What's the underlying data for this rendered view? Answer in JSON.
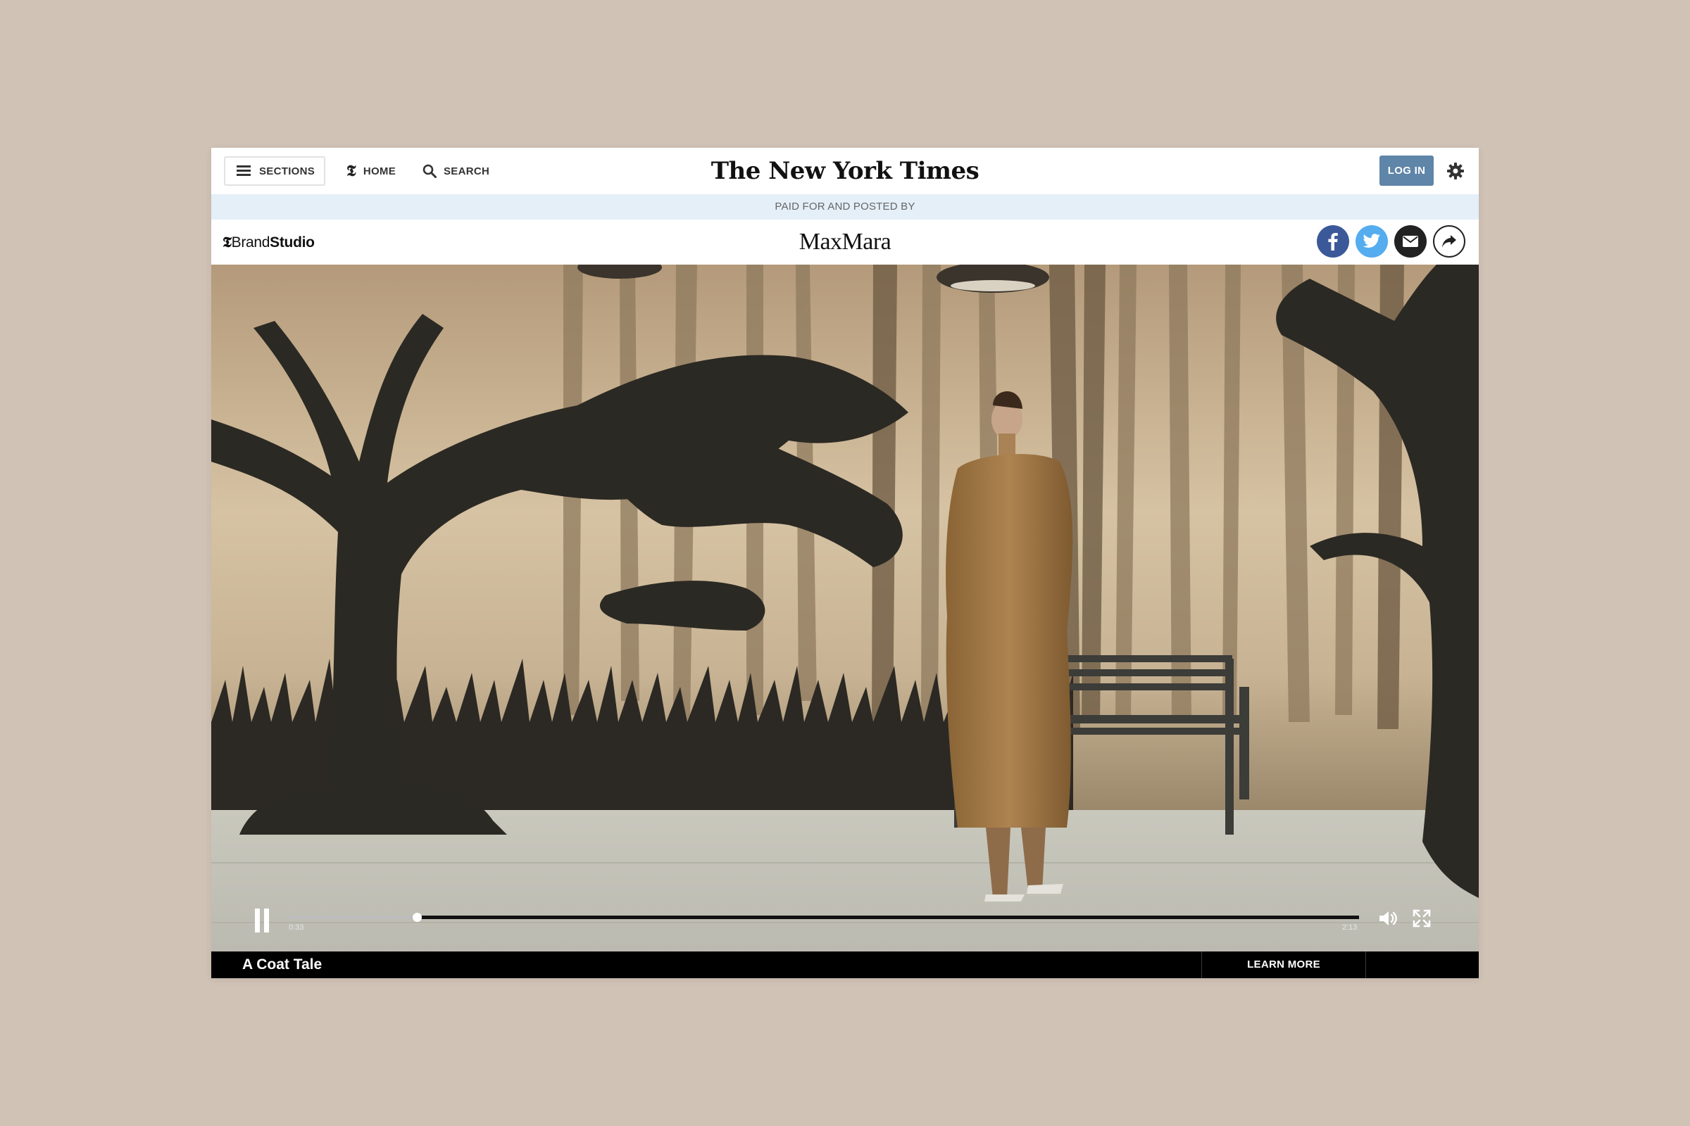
{
  "header": {
    "sections_label": "SECTIONS",
    "home_label": "HOME",
    "search_label": "SEARCH",
    "logo_text": "The New York Times",
    "login_label": "LOG IN",
    "nyt_t": "𝕿"
  },
  "paid_bar": {
    "text": "PAID FOR AND POSTED BY"
  },
  "brand_bar": {
    "studio_t": "𝕿",
    "studio_part1": "Brand",
    "studio_part2": "Studio",
    "advertiser": "MaxMara"
  },
  "video": {
    "current_time": "0:33",
    "duration": "2:13",
    "progress_fraction": 0.12,
    "title": "A Coat Tale",
    "cta_label": "LEARN MORE"
  },
  "colors": {
    "page_background": "#d0c2b5",
    "login_button": "#5f85a8",
    "paid_bar": "#e4eff8",
    "facebook": "#3b5998",
    "twitter": "#55acee"
  },
  "icons": [
    "hamburger-icon",
    "nyt-t-icon",
    "search-icon",
    "gear-icon",
    "facebook-icon",
    "twitter-icon",
    "email-icon",
    "share-icon",
    "pause-icon",
    "volume-icon",
    "fullscreen-icon"
  ]
}
